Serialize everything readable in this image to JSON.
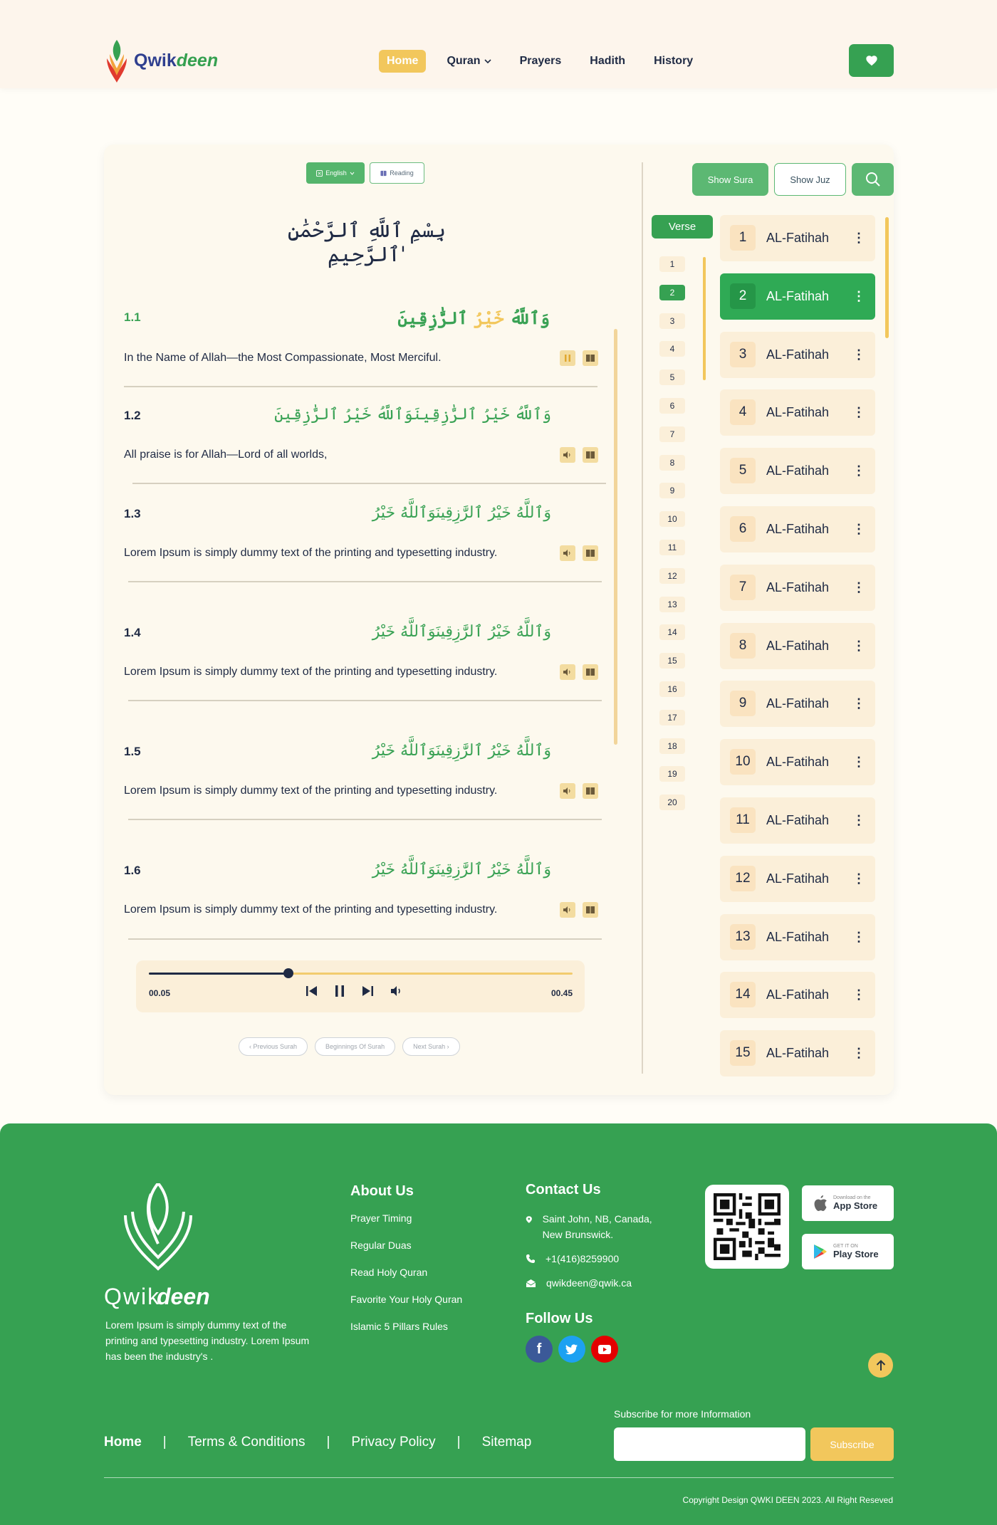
{
  "header": {
    "logo_text_1": "Qwik",
    "logo_text_2": "deen",
    "nav": [
      {
        "label": "Home"
      },
      {
        "label": "Quran"
      },
      {
        "label": "Prayers"
      },
      {
        "label": "Hadith"
      },
      {
        "label": "History"
      }
    ]
  },
  "reader": {
    "language_label": "English",
    "reading_label": "Reading",
    "bismillah": "بِسْمِ ٱللَّهِ ٱلرَّحْمَٰنِ ٱلرَّحِيمِ'",
    "verses": [
      {
        "num": "1.1",
        "arabic_a": "وَٱللَّهُ",
        "arabic_b": "خَيْرُ",
        "arabic_c": "ٱلرَّٰزِقِينَ",
        "text": "In the Name of Allah—the Most Compassionate, Most Merciful."
      },
      {
        "num": "1.2",
        "arabic": "وَٱللَّهُ خَيْرُ ٱلرَّٰزِقِينَوَٱللَّهُ خَيْرُ ٱلرَّٰزِقِينَ",
        "text": "All praise is for Allah—Lord of all worlds,"
      },
      {
        "num": "1.3",
        "arabic": "وَٱللَّهُ خَيْرُ ٱلرَّٰزِقِينَوَٱللَّهُ خَيْرُ",
        "text": "Lorem Ipsum is simply dummy text of the printing and typesetting industry."
      },
      {
        "num": "1.4",
        "arabic": "وَٱللَّهُ خَيْرُ ٱلرَّٰزِقِينَوَٱللَّهُ خَيْرُ",
        "text": "Lorem Ipsum is simply dummy text of the printing and typesetting industry."
      },
      {
        "num": "1.5",
        "arabic": "وَٱللَّهُ خَيْرُ ٱلرَّٰزِقِينَوَٱللَّهُ خَيْرُ",
        "text": "Lorem Ipsum is simply dummy text of the printing and typesetting industry."
      },
      {
        "num": "1.6",
        "arabic": "وَٱللَّهُ خَيْرُ ٱلرَّٰزِقِينَوَٱللَّهُ خَيْرُ",
        "text": "Lorem Ipsum is simply dummy text of the printing and typesetting industry."
      }
    ],
    "player": {
      "elapsed": "00.05",
      "duration": "00.45",
      "progress": 0.33
    },
    "pager": {
      "prev": "Previous Surah",
      "begin": "Beginnings Of Surah",
      "next": "Next Surah"
    }
  },
  "sidebar": {
    "show_sura": "Show Sura",
    "show_juz": "Show Juz",
    "verse_tab": "Verse",
    "verse_numbers": [
      "1",
      "2",
      "3",
      "4",
      "5",
      "6",
      "7",
      "8",
      "9",
      "10",
      "11",
      "12",
      "13",
      "14",
      "15",
      "16",
      "17",
      "18",
      "19",
      "20"
    ],
    "active_verse": "2",
    "suras": [
      {
        "num": "1",
        "name": "AL-Fatihah"
      },
      {
        "num": "2",
        "name": "AL-Fatihah"
      },
      {
        "num": "3",
        "name": "AL-Fatihah"
      },
      {
        "num": "4",
        "name": "AL-Fatihah"
      },
      {
        "num": "5",
        "name": "AL-Fatihah"
      },
      {
        "num": "6",
        "name": "AL-Fatihah"
      },
      {
        "num": "7",
        "name": "AL-Fatihah"
      },
      {
        "num": "8",
        "name": "AL-Fatihah"
      },
      {
        "num": "9",
        "name": "AL-Fatihah"
      },
      {
        "num": "10",
        "name": "AL-Fatihah"
      },
      {
        "num": "11",
        "name": "AL-Fatihah"
      },
      {
        "num": "12",
        "name": "AL-Fatihah"
      },
      {
        "num": "13",
        "name": "AL-Fatihah"
      },
      {
        "num": "14",
        "name": "AL-Fatihah"
      },
      {
        "num": "15",
        "name": "AL-Fatihah"
      }
    ],
    "active_sura": "2"
  },
  "footer": {
    "about_text": "Lorem Ipsum is simply dummy text of the printing and typesetting industry.  Lorem Ipsum has been the industry's .",
    "about_heading": "About Us",
    "about_links": [
      "Prayer Timing",
      "Regular Duas",
      "Read Holy Quran",
      "Favorite Your Holy Quran",
      "Islamic 5 Pillars Rules"
    ],
    "contact_heading": "Contact Us",
    "address": "Saint John, NB, Canada, New Brunswick.",
    "phone": "+1(416)8259900",
    "email": "qwikdeen@qwik.ca",
    "follow_heading": "Follow Us",
    "app_store_small": "Download on the",
    "app_store": "App Store",
    "play_store_small": "GET IT ON",
    "play_store": "Play Store",
    "nav": [
      "Home",
      "Terms & Conditions",
      "Privacy Policy",
      "Sitemap"
    ],
    "subscribe_label": "Subscribe for more Information",
    "subscribe_btn": "Subscribe",
    "copyright": "Copyright Design QWKI DEEN 2023.  All Right Reseved"
  },
  "colors": {
    "green": "#36a152",
    "yellow": "#f2c75c",
    "navy": "#1f2a44",
    "cream": "#fdf9ee"
  }
}
